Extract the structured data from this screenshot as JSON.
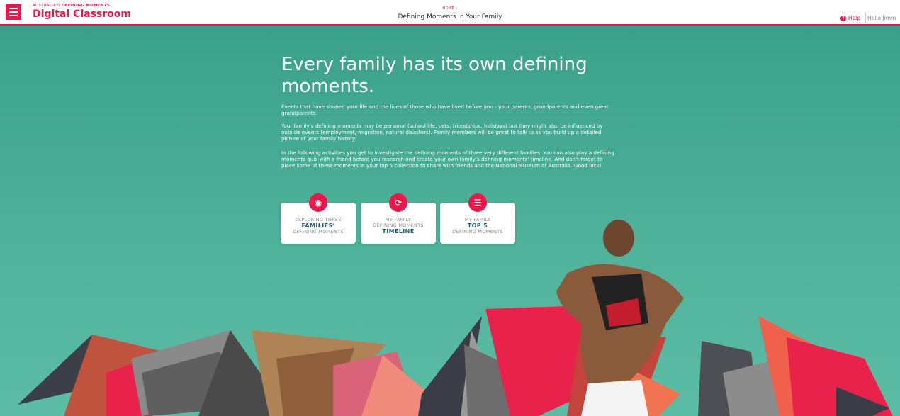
{
  "header": {
    "brand_small_prefix": "AUSTRALIA'S ",
    "brand_small_bold": "DEFINING MOMENTS",
    "brand_big": "Digital Classroom",
    "breadcrumb": "HOME ›",
    "title": "Defining Moments in Your Family",
    "help": "Help",
    "user": "Hello Jimm"
  },
  "main": {
    "headline": "Every family has its own defining moments.",
    "paragraphs": [
      "Events that have shaped your life and the lives of those who have lived before you - your parents, grandparents and even great grandparents.",
      "Your family's defining moments may be personal (school life, pets, friendships, holidays) but they might also be influenced by outside events (employment, migration, natural disasters). Family members will be great to talk to as you build up a detailed picture of your family history.",
      "In the following activities you get to investigate the defining moments of three very different families. You can also play a defining moments quiz with a friend before you research and create your own family's defining moments' timeline. And don't forget to place some of these moments in your top 5 collection to share with friends and the National Museum of Australia. Good luck!"
    ],
    "cards": [
      {
        "icon": "people-icon",
        "line1": "EXPLORING THREE",
        "bold": "FAMILIES'",
        "line3": "DEFINING MOMENTS"
      },
      {
        "icon": "timeline-icon",
        "line1": "MY FAMILY",
        "line2": "DEFINING MOMENTS",
        "bold": "TIMELINE"
      },
      {
        "icon": "layers-icon",
        "line1": "MY FAMILY",
        "bold": "TOP 5",
        "line3": "DEFINING MOMENTS"
      }
    ]
  },
  "colors": {
    "accent": "#e8194a",
    "teal": "#4aae97",
    "navy": "#1f5f78"
  }
}
